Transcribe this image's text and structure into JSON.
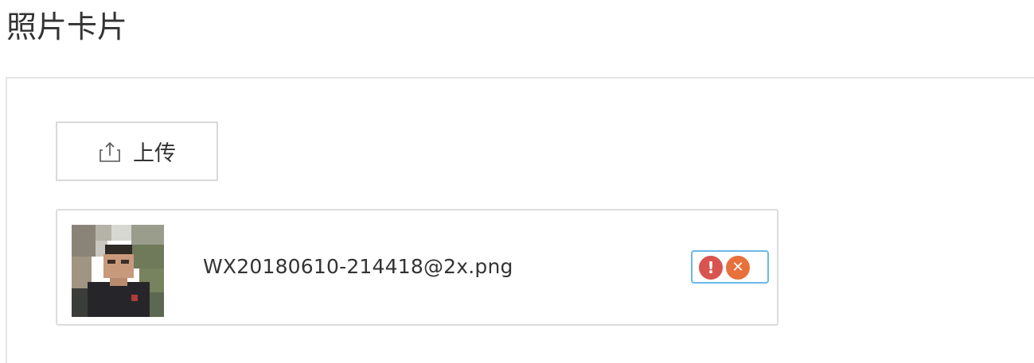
{
  "page": {
    "title": "照片卡片"
  },
  "upload": {
    "icon": "upload-icon",
    "label": "上传"
  },
  "file": {
    "name": "WX20180610-214418@2x.png",
    "thumbnail": "photo-thumbnail",
    "status_icon": "error-icon",
    "status_glyph": "!",
    "remove_icon": "close-icon",
    "remove_glyph": "✕"
  },
  "colors": {
    "error": "#d9534f",
    "remove": "#e8703a",
    "focus_border": "#6ab8e8"
  }
}
